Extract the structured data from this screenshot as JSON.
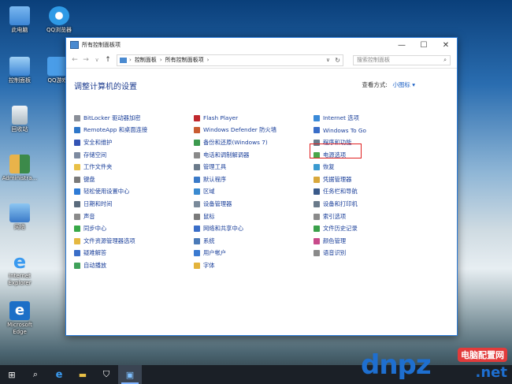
{
  "desktop_icons": [
    {
      "label": "此电脑",
      "color": "#5aa0e8"
    },
    {
      "label": "QQ浏览器",
      "color": "#2e9ae6"
    },
    {
      "label": "控制面板",
      "color": "#3d86d6"
    },
    {
      "label": "QQ游戏",
      "color": "#4a9de8"
    },
    {
      "label": "回收站",
      "color": "#cfd8df"
    },
    {
      "label": "Administra...",
      "color": "#e9b34a"
    },
    {
      "label": "网络",
      "color": "#4a8fd8"
    },
    {
      "label": "Internet Explorer",
      "color": "#2f7fd3"
    },
    {
      "label": "Microsoft Edge",
      "color": "#1c6fc7"
    }
  ],
  "window": {
    "title": "所有控制面板项",
    "minimize": "—",
    "maximize": "☐",
    "close": "✕"
  },
  "address": {
    "back": "←",
    "forward": "→",
    "recent": "∨",
    "up": "↑",
    "path": [
      "控制面板",
      "所有控制面板项"
    ],
    "path_sep": "›",
    "dropdown": "∨",
    "refresh": "↻",
    "search_placeholder": "搜索控制面板",
    "search_icon": "⌕"
  },
  "main": {
    "heading": "调整计算机的设置",
    "view_by_label": "查看方式:",
    "view_by_value": "小图标 ▾"
  },
  "columns": [
    [
      {
        "label": "BitLocker 驱动器加密",
        "color": "#8a8f98"
      },
      {
        "label": "RemoteApp 和桌面连接",
        "color": "#2f77c9"
      },
      {
        "label": "安全和维护",
        "color": "#3454b4"
      },
      {
        "label": "存储空间",
        "color": "#7d8aa0"
      },
      {
        "label": "工作文件夹",
        "color": "#e9c046"
      },
      {
        "label": "键盘",
        "color": "#7a7a7a"
      },
      {
        "label": "轻松使用设置中心",
        "color": "#2e7bd6"
      },
      {
        "label": "日期和时间",
        "color": "#5a6b7c"
      },
      {
        "label": "声音",
        "color": "#8a8a8a"
      },
      {
        "label": "同步中心",
        "color": "#38a848"
      },
      {
        "label": "文件资源管理器选项",
        "color": "#e5b840"
      },
      {
        "label": "疑难解答",
        "color": "#3a6ec8"
      },
      {
        "label": "自动播放",
        "color": "#3fa15a"
      }
    ],
    [
      {
        "label": "Flash Player",
        "color": "#c0282d"
      },
      {
        "label": "Windows Defender 防火墙",
        "color": "#c95c32"
      },
      {
        "label": "备份和还原(Windows 7)",
        "color": "#3c9a4e"
      },
      {
        "label": "电话和调制解调器",
        "color": "#8a8a8a"
      },
      {
        "label": "管理工具",
        "color": "#6a7a8a"
      },
      {
        "label": "默认程序",
        "color": "#3a7ac8"
      },
      {
        "label": "区域",
        "color": "#3a8ad0"
      },
      {
        "label": "设备管理器",
        "color": "#7a8a9a"
      },
      {
        "label": "鼠标",
        "color": "#7a7a7a"
      },
      {
        "label": "网络和共享中心",
        "color": "#3a6ec8"
      },
      {
        "label": "系统",
        "color": "#4a7ab8"
      },
      {
        "label": "用户帐户",
        "color": "#3a7ad0"
      },
      {
        "label": "字体",
        "color": "#e3b33c"
      }
    ],
    [
      {
        "label": "Internet 选项",
        "color": "#3a8ad8"
      },
      {
        "label": "Windows To Go",
        "color": "#3a6ec8"
      },
      {
        "label": "程序和功能",
        "color": "#6a7a8a"
      },
      {
        "label": "电源选项",
        "color": "#4aa84a"
      },
      {
        "label": "恢复",
        "color": "#3a9ad0"
      },
      {
        "label": "凭据管理器",
        "color": "#d9a83c"
      },
      {
        "label": "任务栏和导航",
        "color": "#3a5a8a"
      },
      {
        "label": "设备和打印机",
        "color": "#6a7a8a"
      },
      {
        "label": "索引选项",
        "color": "#8a8a8a"
      },
      {
        "label": "文件历史记录",
        "color": "#3aa04a"
      },
      {
        "label": "颜色管理",
        "color": "#c84a8a"
      },
      {
        "label": "语音识别",
        "color": "#8a8a8a"
      }
    ]
  ],
  "taskbar": {
    "start": "⊞",
    "search": "⌕",
    "edge": "e",
    "explorer": "▬",
    "store": "⛉",
    "control_panel": "▣"
  },
  "watermark": {
    "logo": "dnpz",
    "net": ".net",
    "cn": "电脑配置网"
  }
}
